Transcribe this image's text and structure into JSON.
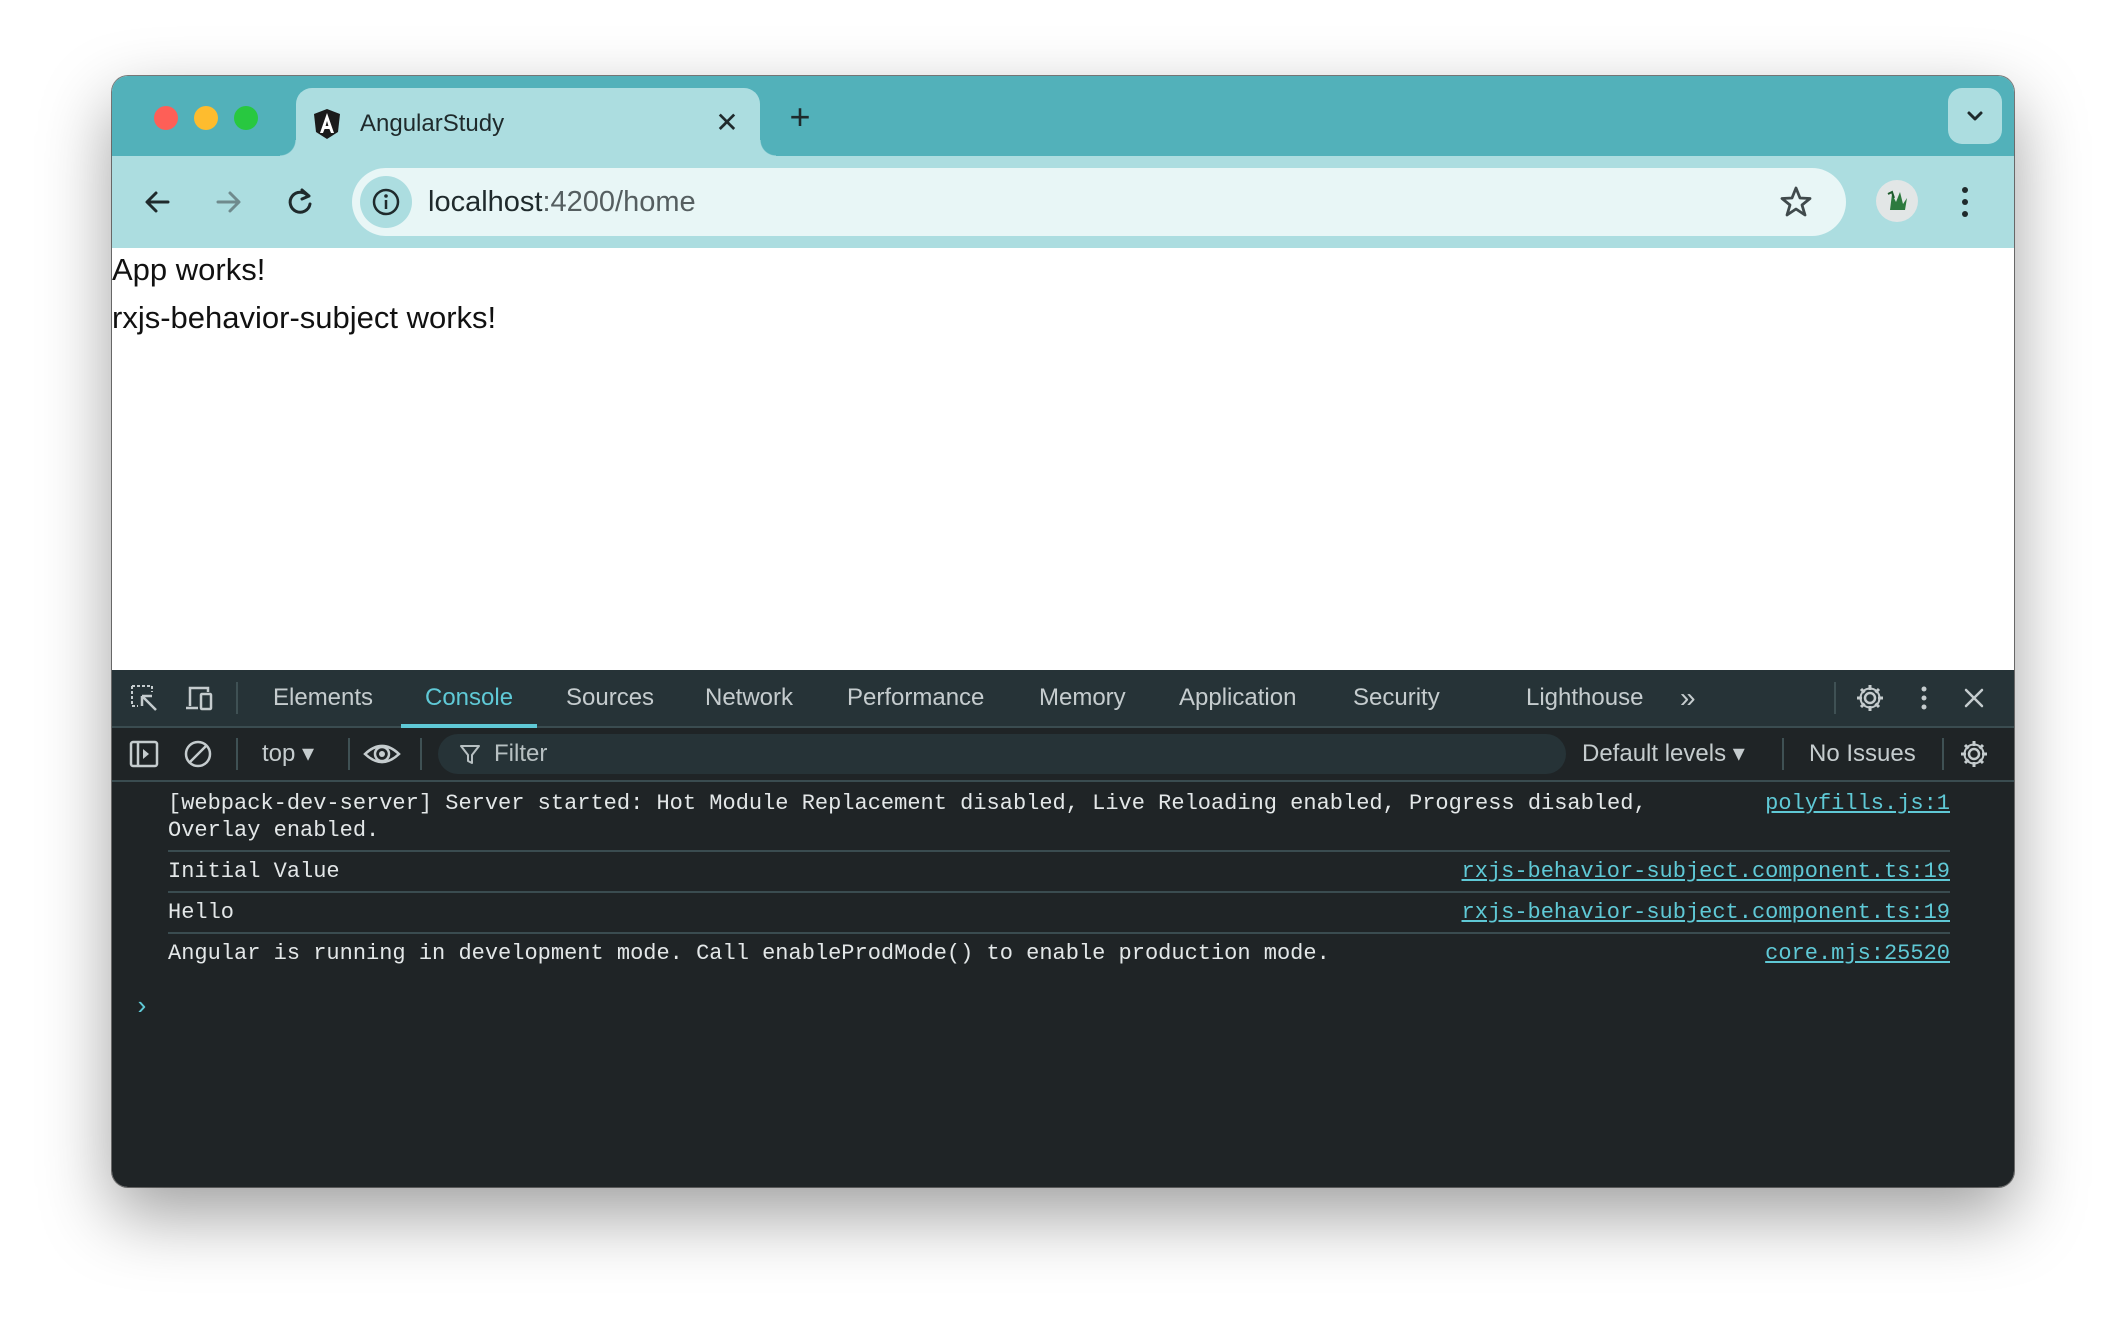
{
  "browser": {
    "tab": {
      "title": "AngularStudy",
      "icon": "angular-logo-icon",
      "close_label": "✕"
    },
    "new_tab_label": "+",
    "tab_search_icon": "chevron-down-icon",
    "toolbar": {
      "back_icon": "arrow-left-icon",
      "forward_icon": "arrow-right-icon",
      "reload_icon": "reload-icon",
      "site_info_icon": "info-icon",
      "url_host": "localhost",
      "url_rest": ":4200/home",
      "bookmark_icon": "star-icon",
      "profile_icon": "avatar-icon",
      "menu_icon": "kebab-menu-icon"
    },
    "colors": {
      "tabstrip": "#52b1ba",
      "toolbar": "#acdde0",
      "omnibox": "#e8f6f6"
    }
  },
  "page": {
    "lines": [
      "App works!",
      "rxjs-behavior-subject works!"
    ]
  },
  "devtools": {
    "tabs": [
      {
        "label": "Elements",
        "active": false
      },
      {
        "label": "Console",
        "active": true
      },
      {
        "label": "Sources",
        "active": false
      },
      {
        "label": "Network",
        "active": false
      },
      {
        "label": "Performance",
        "active": false
      },
      {
        "label": "Memory",
        "active": false
      },
      {
        "label": "Application",
        "active": false
      },
      {
        "label": "Security",
        "active": false
      },
      {
        "label": "Lighthouse",
        "active": false
      }
    ],
    "more_tabs_label": "»",
    "accent_color": "#5fc9d6",
    "console_toolbar": {
      "context": "top ▾",
      "filter_placeholder": "Filter",
      "levels": "Default levels ▾",
      "issues": "No Issues"
    },
    "logs": [
      {
        "message": "[webpack-dev-server] Server started: Hot Module Replacement disabled, Live Reloading enabled, Progress disabled,\nOverlay enabled.",
        "source": "polyfills.js:1"
      },
      {
        "message": "Initial Value",
        "source": "rxjs-behavior-subject.component.ts:19"
      },
      {
        "message": "Hello",
        "source": "rxjs-behavior-subject.component.ts:19"
      },
      {
        "message": "Angular is running in development mode. Call enableProdMode() to enable production mode.",
        "source": "core.mjs:25520"
      }
    ],
    "prompt_symbol": "›"
  }
}
